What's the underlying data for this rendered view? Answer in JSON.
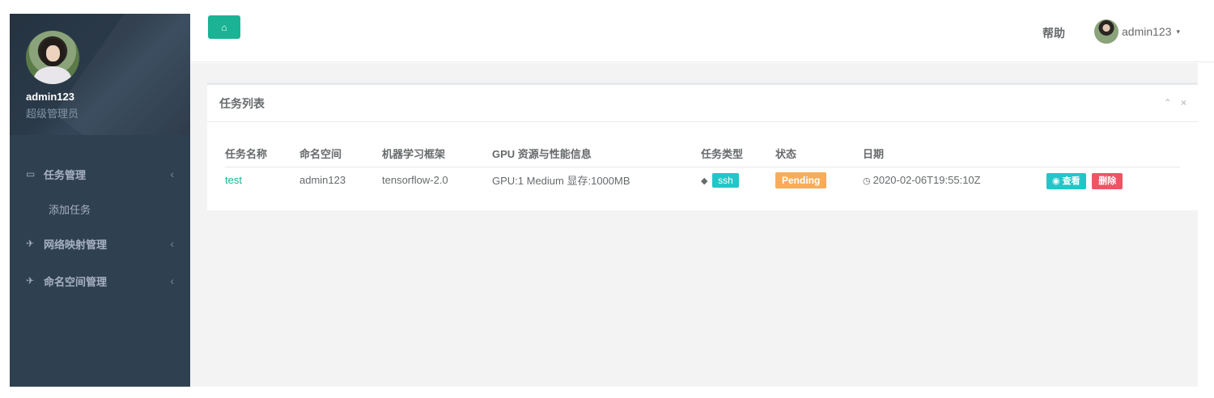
{
  "sidebar": {
    "profile": {
      "name": "admin123",
      "role": "超级管理员"
    },
    "items": [
      {
        "label": "任务管理",
        "icon": "desktop-icon",
        "glyph": "▭"
      },
      {
        "label": "网络映射管理",
        "icon": "plane-icon",
        "glyph": "✈"
      },
      {
        "label": "命名空间管理",
        "icon": "plane-icon",
        "glyph": "✈"
      }
    ],
    "subitems": [
      {
        "label": "添加任务"
      }
    ],
    "chevron": "‹"
  },
  "topbar": {
    "home_icon": "⌂",
    "help_label": "帮助",
    "user_label": "admin123",
    "caret": "▾"
  },
  "panel": {
    "title": "任务列表",
    "collapse_icon": "⌃",
    "close_icon": "×"
  },
  "table": {
    "headers": [
      "任务名称",
      "命名空间",
      "机器学习框架",
      "GPU 资源与性能信息",
      "任务类型",
      "状态",
      "日期",
      ""
    ],
    "rows": [
      {
        "name": "test",
        "namespace": "admin123",
        "framework": "tensorflow-2.0",
        "gpu": "GPU:1 Medium 显存:1000MB",
        "type": "ssh",
        "status": "Pending",
        "date": "2020-02-06T19:55:10Z",
        "view_label": "查看",
        "delete_label": "删除"
      }
    ]
  },
  "colors": {
    "accent": "#1ab394",
    "sidebar": "#2f4050",
    "info": "#23c6c8",
    "warning": "#f8ac59",
    "danger": "#ed5565"
  }
}
